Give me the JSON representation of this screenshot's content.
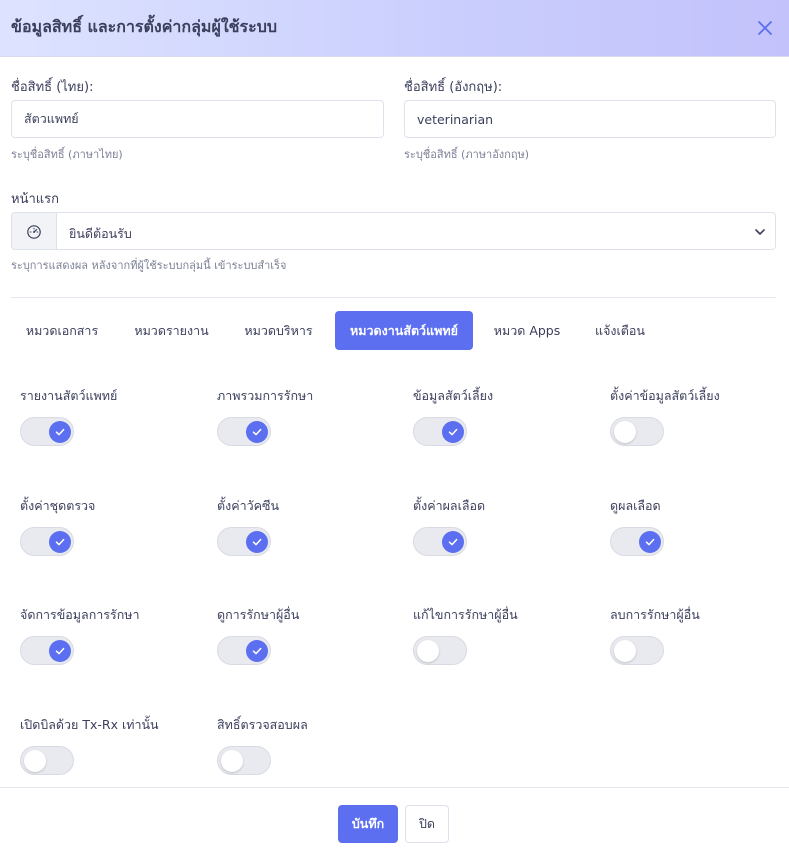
{
  "dialog": {
    "title": "ข้อมูลสิทธิ์ และการตั้งค่ากลุ่มผู้ใช้ระบบ"
  },
  "form": {
    "name_th": {
      "label": "ชื่อสิทธิ์ (ไทย):",
      "value": "สัตวแพทย์",
      "help": "ระบุชื่อสิทธิ์ (ภาษาไทย)"
    },
    "name_en": {
      "label": "ชื่อสิทธิ์ (อังกฤษ):",
      "value": "veterinarian",
      "help": "ระบุชื่อสิทธิ์ (ภาษาอังกฤษ)"
    },
    "homepage": {
      "label": "หน้าแรก",
      "addon_icon": "gauge-icon",
      "selected": "ยินดีต้อนรับ",
      "help": "ระบุการแสดงผล หลังจากที่ผู้ใช้ระบบกลุ่มนี้ เข้าระบบสำเร็จ"
    }
  },
  "tabs": [
    {
      "label": "หมวดเอกสาร",
      "active": false
    },
    {
      "label": "หมวดรายงาน",
      "active": false
    },
    {
      "label": "หมวดบริหาร",
      "active": false
    },
    {
      "label": "หมวดงานสัตว์แพทย์",
      "active": true
    },
    {
      "label": "หมวด Apps",
      "active": false
    },
    {
      "label": "แจ้งเตือน",
      "active": false
    }
  ],
  "permissions": [
    {
      "label": "รายงานสัตว์แพทย์",
      "enabled": true
    },
    {
      "label": "ภาพรวมการรักษา",
      "enabled": true
    },
    {
      "label": "ข้อมูลสัตว์เลี้ยง",
      "enabled": true
    },
    {
      "label": "ตั้งค่าข้อมูลสัตว์เลี้ยง",
      "enabled": false
    },
    {
      "label": "ตั้งค่าชุดตรวจ",
      "enabled": true
    },
    {
      "label": "ตั้งค่าวัคซีน",
      "enabled": true
    },
    {
      "label": "ตั้งค่าผลเลือด",
      "enabled": true
    },
    {
      "label": "ดูผลเลือด",
      "enabled": true
    },
    {
      "label": "จัดการข้อมูลการรักษา",
      "enabled": true
    },
    {
      "label": "ดูการรักษาผู้อื่น",
      "enabled": true
    },
    {
      "label": "แก้ไขการรักษาผู้อื่น",
      "enabled": false
    },
    {
      "label": "ลบการรักษาผู้อื่น",
      "enabled": false
    },
    {
      "label": "เปิดบิลด้วย Tx-Rx เท่านั้น",
      "enabled": false
    },
    {
      "label": "สิทธิ์ตรวจสอบผล",
      "enabled": false
    }
  ],
  "footer": {
    "save_label": "บันทึก",
    "close_label": "ปิด"
  },
  "colors": {
    "accent": "#5b6ff0",
    "text": "#3b3f5c",
    "muted": "#7d8196",
    "toggle_off": "#e8eaef"
  }
}
